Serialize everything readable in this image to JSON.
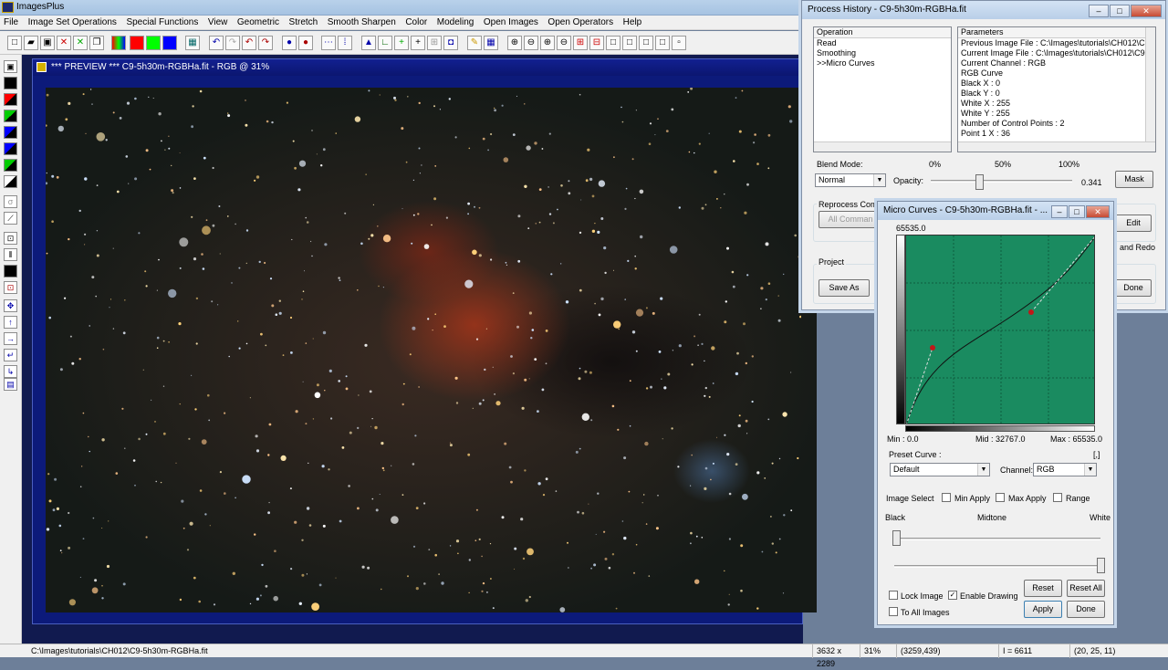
{
  "app": {
    "title": "ImagesPlus"
  },
  "menu": [
    "File",
    "Image Set Operations",
    "Special Functions",
    "View",
    "Geometric",
    "Stretch",
    "Smooth Sharpen",
    "Color",
    "Modeling",
    "Open Images",
    "Open Operators",
    "Help"
  ],
  "preview": {
    "title": "*** PREVIEW *** C9-5h30m-RGBHa.fit - RGB @ 31%"
  },
  "status": {
    "path": "C:\\Images\\tutorials\\CH012\\C9-5h30m-RGBHa.fit",
    "dims": "3632 x 2289",
    "zoom": "31%",
    "coords": "(3259,439)",
    "intensity": "I = 6611",
    "rgb": "(20, 25, 11)"
  },
  "process_history": {
    "title": "Process History - C9-5h30m-RGBHa.fit",
    "operation_header": "Operation",
    "operations": [
      "Read",
      "Smoothing",
      ">>Micro Curves"
    ],
    "parameters_header": "Parameters",
    "parameters": [
      "Previous Image File : C:\\Images\\tutorials\\CH012\\C9",
      "Current Image File : C:\\Images\\tutorials\\CH012\\C9-5",
      "Current Channel : RGB",
      "RGB Curve",
      "Black X : 0",
      "Black Y : 0",
      "White X : 255",
      "White Y : 255",
      "Number of Control Points : 2",
      "Point 1 X : 36"
    ],
    "blend_label": "Blend Mode:",
    "blend_value": "Normal",
    "opacity_label": "Opacity:",
    "opacity_value": "0.341",
    "opacity_fraction": 0.341,
    "pct0": "0%",
    "pct50": "50%",
    "pct100": "100%",
    "mask": "Mask",
    "reprocess_label": "Reprocess Com",
    "all_commands": "All Comman",
    "edit": "Edit",
    "and_redo": "and Redo",
    "project_label": "Project",
    "save_as": "Save As",
    "done": "Done"
  },
  "micro_curves": {
    "title": "Micro Curves - C9-5h30m-RGBHa.fit - ...",
    "ymax_label": "65535.0",
    "min_label": "Min : 0.0",
    "mid_label": "Mid : 32767.0",
    "max_label": "Max : 65535.0",
    "preset_label": "Preset Curve :",
    "preset_value": "Default",
    "bracket": "[,]",
    "channel_label": "Channel:",
    "channel_value": "RGB",
    "image_select_label": "Image Select",
    "min_apply": "Min Apply",
    "max_apply": "Max Apply",
    "range": "Range",
    "black": "Black",
    "midtone": "Midtone",
    "white": "White",
    "lock_image": "Lock Image",
    "enable_drawing": "Enable Drawing",
    "to_all_images": "To All Images",
    "reset": "Reset",
    "reset_all": "Reset All",
    "apply": "Apply",
    "done": "Done",
    "graph_color": "#1a8b60"
  }
}
